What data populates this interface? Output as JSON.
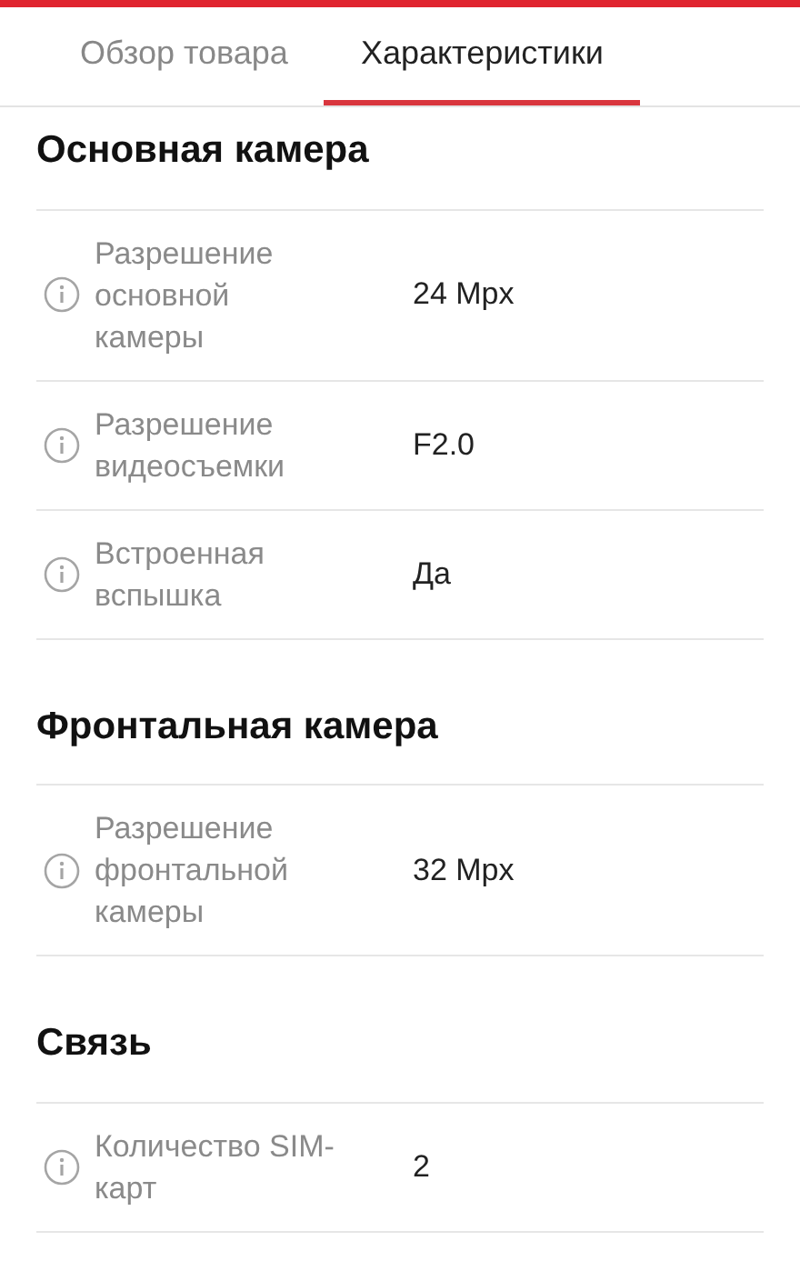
{
  "tabs": [
    {
      "label": "Обзор товара",
      "selected": false
    },
    {
      "label": "Характеристики",
      "selected": true
    }
  ],
  "sections": [
    {
      "title": "Основная камера",
      "rows": [
        {
          "label": "Разрешение основной камеры",
          "value": "24 Mpx"
        },
        {
          "label": "Разрешение видеосъемки",
          "value": "F2.0"
        },
        {
          "label": "Встроенная вспышка",
          "value": "Да"
        }
      ]
    },
    {
      "title": "Фронтальная камера",
      "rows": [
        {
          "label": "Разрешение фронтальной камеры",
          "value": "32 Mpx"
        }
      ]
    },
    {
      "title": "Связь",
      "rows": [
        {
          "label": "Количество SIM-карт",
          "value": "2"
        }
      ]
    }
  ]
}
